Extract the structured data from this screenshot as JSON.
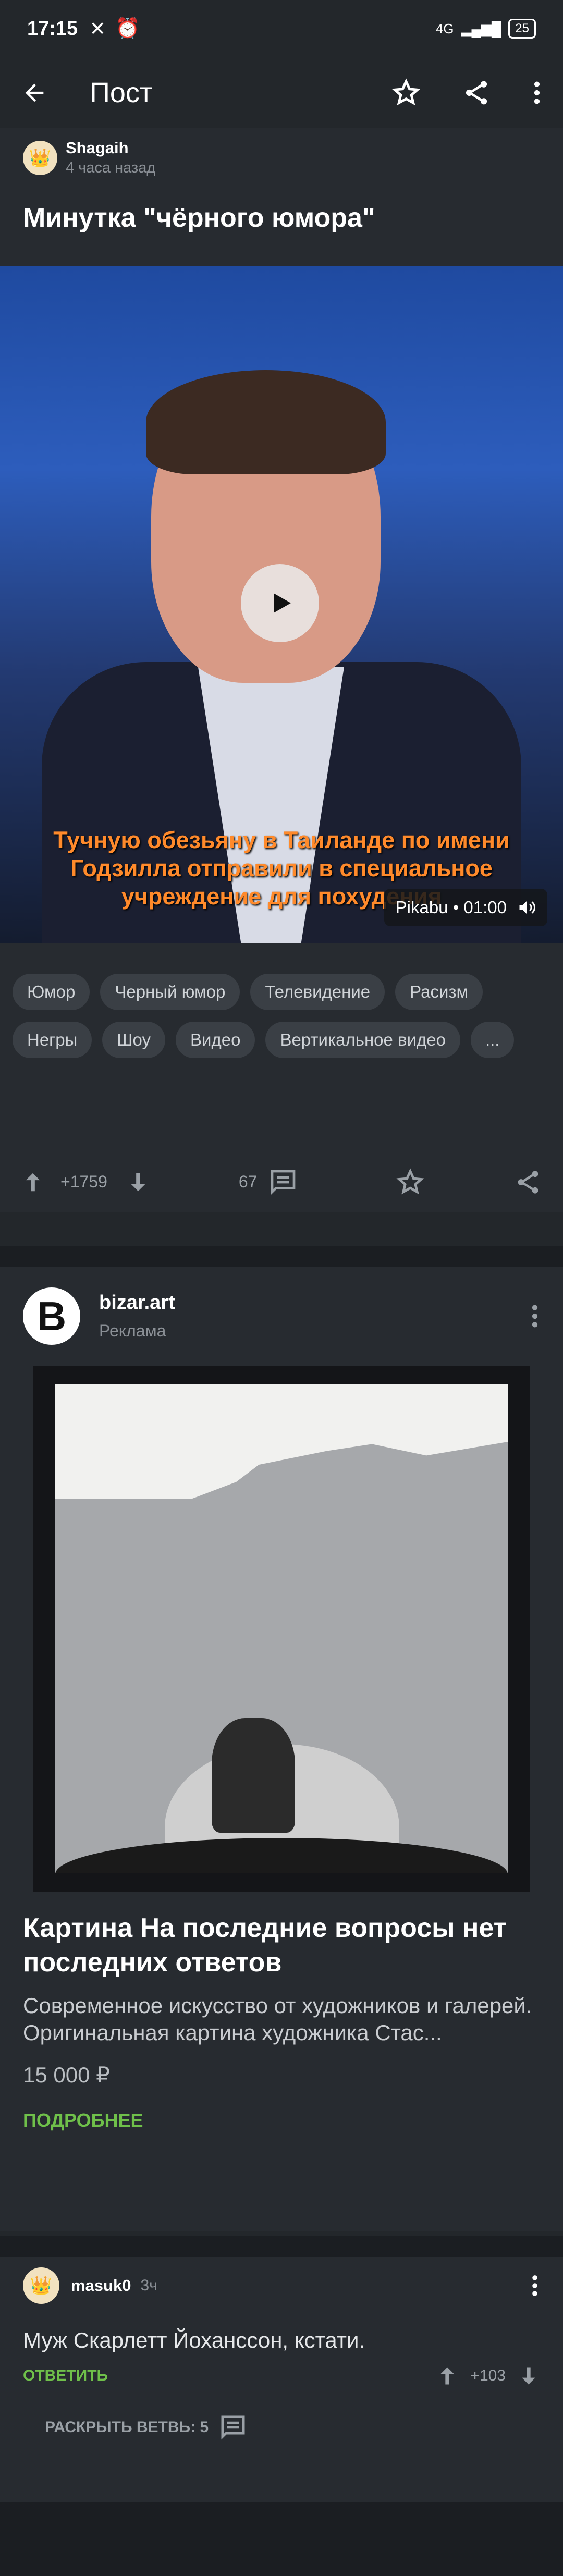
{
  "status_bar": {
    "time": "17:15",
    "network": "4G",
    "battery": "25"
  },
  "app_bar": {
    "title": "Пост"
  },
  "post": {
    "author": "Shagaih",
    "time": "4 часа назад",
    "title": "Минутка \"чёрного юмора\"",
    "video": {
      "subtitle_line1": "Тучную обезьяну в Таиланде по имени",
      "subtitle_line2": "Годзилла отправили в специальное",
      "subtitle_line3": "учреждение для похудения",
      "source_duration": "Pikabu • 01:00"
    },
    "tags": [
      "Юмор",
      "Черный юмор",
      "Телевидение",
      "Расизм",
      "Негры",
      "Шоу",
      "Видео",
      "Вертикальное видео",
      "..."
    ],
    "rating": "+1759",
    "comments_count": "67"
  },
  "ad": {
    "advertiser": "bizar.art",
    "label": "Реклама",
    "title": "Картина На последние вопросы нет последних ответов",
    "description": "Современное искусство от художников и галерей. Оригинальная картина художника Стас...",
    "price": "15 000 ₽",
    "cta": "ПОДРОБНЕЕ"
  },
  "comment": {
    "author": "masuk0",
    "time": "3ч",
    "text": "Муж Скарлетт Йоханссон, кстати.",
    "reply": "ОТВЕТИТЬ",
    "rating": "+103",
    "expand_branch": "РАСКРЫТЬ ВЕТВЬ: 5"
  },
  "colors": {
    "background": "#23272b",
    "accent_green": "#6fc04a",
    "subtitle_orange": "#ff8a2b"
  }
}
